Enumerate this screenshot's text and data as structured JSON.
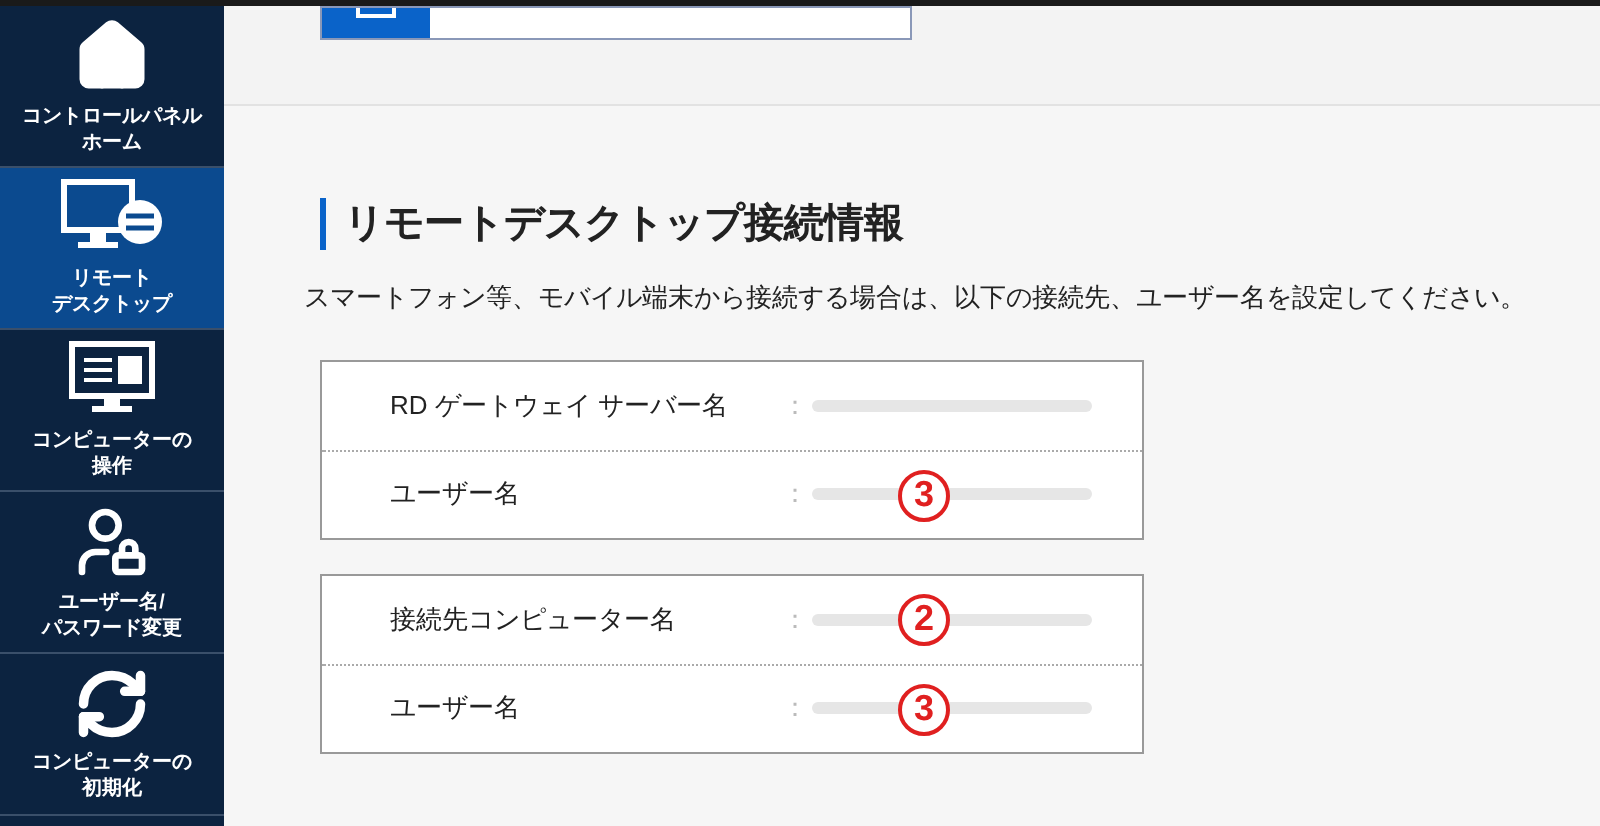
{
  "sidebar": {
    "items": [
      {
        "lines": [
          "コントロールパネル",
          "ホーム"
        ],
        "selected": false
      },
      {
        "lines": [
          "リモート",
          "デスクトップ"
        ],
        "selected": true
      },
      {
        "lines": [
          "コンピューターの",
          "操作"
        ],
        "selected": false
      },
      {
        "lines": [
          "ユーザー名/",
          "パスワード変更"
        ],
        "selected": false
      },
      {
        "lines": [
          "コンピューターの",
          "初期化"
        ],
        "selected": false
      }
    ]
  },
  "section": {
    "title": "リモートデスクトップ接続情報",
    "description": "スマートフォン等、モバイル端末から接続する場合は、以下の接続先、ユーザー名を設定してください。",
    "tables": [
      {
        "rows": [
          {
            "label": "RD ゲートウェイ サーバー名",
            "separator": "："
          },
          {
            "label": "ユーザー名",
            "separator": "：",
            "annotation": "3"
          }
        ]
      },
      {
        "rows": [
          {
            "label": "接続先コンピューター名",
            "separator": "：",
            "annotation": "2"
          },
          {
            "label": "ユーザー名",
            "separator": "：",
            "annotation": "3"
          }
        ]
      }
    ]
  }
}
